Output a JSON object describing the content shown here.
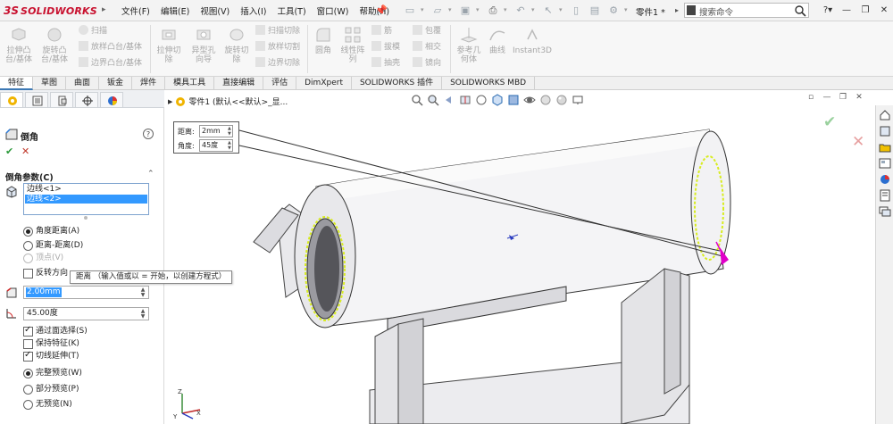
{
  "app": {
    "logo_ds": "3S",
    "logo_text": "SOLIDWORKS",
    "document_title": "零件1 *",
    "search_placeholder": "搜索命令"
  },
  "menu": [
    "文件(F)",
    "编辑(E)",
    "视图(V)",
    "插入(I)",
    "工具(T)",
    "窗口(W)",
    "帮助(H)"
  ],
  "ribbon": {
    "extrude_boss": "拉伸凸\n台/基体",
    "revolve_boss": "旋转凸\n台/基体",
    "sweep": "扫描",
    "loft": "放样凸台/基体",
    "boundary_boss": "边界凸台/基体",
    "extrude_cut": "拉伸切\n除",
    "hole_wizard": "异型孔\n向导",
    "revolve_cut": "旋转切\n除",
    "swept_cut": "扫描切除",
    "lofted_cut": "放样切割",
    "boundary_cut": "边界切除",
    "fillet": "圆角",
    "linear_pattern": "线性阵\n列",
    "rib": "筋",
    "draft": "拔模",
    "shell": "抽壳",
    "wrap": "包覆",
    "intersect": "相交",
    "mirror": "镜向",
    "ref_geometry": "参考几\n何体",
    "curves": "曲线",
    "instant3d": "Instant3D"
  },
  "tabs": [
    "特征",
    "草图",
    "曲面",
    "钣金",
    "焊件",
    "模具工具",
    "直接编辑",
    "评估",
    "DimXpert",
    "SOLIDWORKS 插件",
    "SOLIDWORKS MBD"
  ],
  "panel": {
    "title": "倒角",
    "help": "?",
    "ok": "✔",
    "cancel": "✕",
    "section_title": "倒角参数(C)",
    "edges": [
      "边线<1>",
      "边线<2>"
    ],
    "radios": {
      "angle_distance": "角度距离(A)",
      "distance_distance": "距离-距离(D)",
      "vertex": "顶点(V)"
    },
    "reverse_direction": "反转方向",
    "tooltip": "距离 （输入值或以 = 开始，以创建方程式）",
    "distance_value": "2.00mm",
    "angle_value": "45.00度",
    "options": {
      "select_through_faces": "通过面选择(S)",
      "keep_features": "保持特征(K)",
      "tangent_propagation": "切线延伸(T)",
      "full_preview": "完整预览(W)",
      "partial_preview": "部分预览(P)",
      "no_preview": "无预览(N)"
    }
  },
  "viewport": {
    "tree_label": "零件1 (默认<<默认>_显..."
  },
  "callout": {
    "distance_label": "距离:",
    "distance_value": "2mm",
    "angle_label": "角度:",
    "angle_value": "45度"
  },
  "colors": {
    "accent": "#3399ff",
    "brand_red": "#c8102e",
    "ok_green": "#2d9a3c",
    "cancel_red": "#c0392b",
    "edge_highlight": "#d8ec1e",
    "arrow_magenta": "#e000c8"
  }
}
